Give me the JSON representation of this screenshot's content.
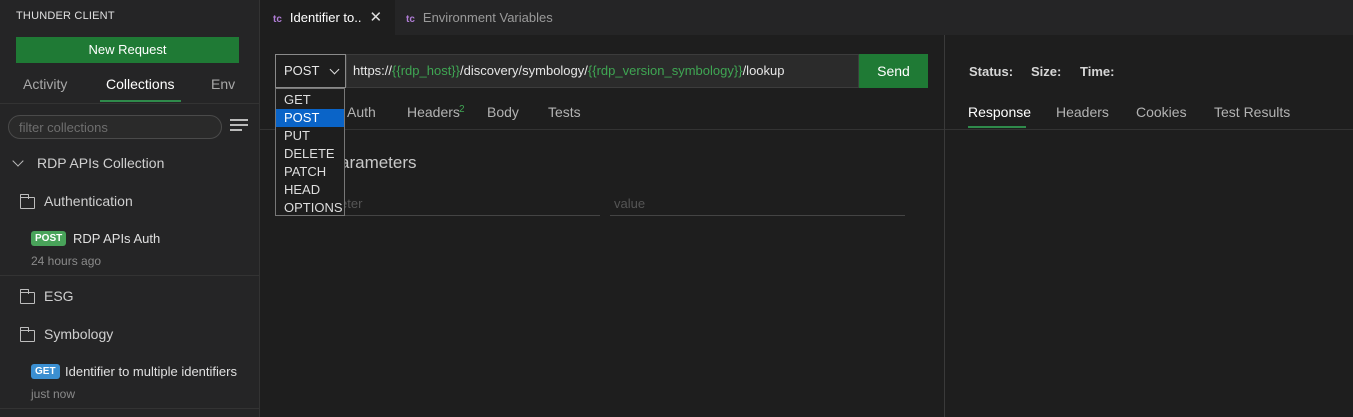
{
  "sidebar": {
    "title": "THUNDER CLIENT",
    "new_request": "New Request",
    "tabs": [
      "Activity",
      "Collections",
      "Env"
    ],
    "filter_placeholder": "filter collections",
    "collection_name": "RDP APIs Collection",
    "folders": [
      "Authentication",
      "ESG",
      "Symbology"
    ],
    "requests": [
      {
        "method": "POST",
        "name": "RDP APIs Auth",
        "time": "24 hours ago"
      },
      {
        "method": "GET",
        "name": "Identifier to multiple identifiers",
        "time": "just now"
      }
    ]
  },
  "editor_tabs": [
    {
      "badge": "tc",
      "label": "Identifier to..",
      "active": true
    },
    {
      "badge": "tc",
      "label": "Environment Variables",
      "active": false
    }
  ],
  "request": {
    "method": "POST",
    "url_parts": {
      "prefix": "https://",
      "var1": "{{rdp_host}}",
      "mid": "/discovery/symbology/",
      "var2": "{{rdp_version_symbology}}",
      "suffix": "/lookup"
    },
    "send_label": "Send",
    "method_options": [
      "GET",
      "POST",
      "PUT",
      "DELETE",
      "PATCH",
      "HEAD",
      "OPTIONS"
    ],
    "selected_option": "POST",
    "tabs": {
      "auth": "Auth",
      "headers": "Headers",
      "headers_count": "2",
      "body": "Body",
      "tests": "Tests"
    },
    "params_title": "arameters",
    "param_placeholder": "eter",
    "value_placeholder": "value"
  },
  "response": {
    "status_label": "Status:",
    "size_label": "Size:",
    "time_label": "Time:",
    "tabs": [
      "Response",
      "Headers",
      "Cookies",
      "Test Results"
    ]
  },
  "colors": {
    "accent_green": "#1f7a35",
    "variable_green": "#3fa653",
    "selection_blue": "#0a64c8"
  }
}
